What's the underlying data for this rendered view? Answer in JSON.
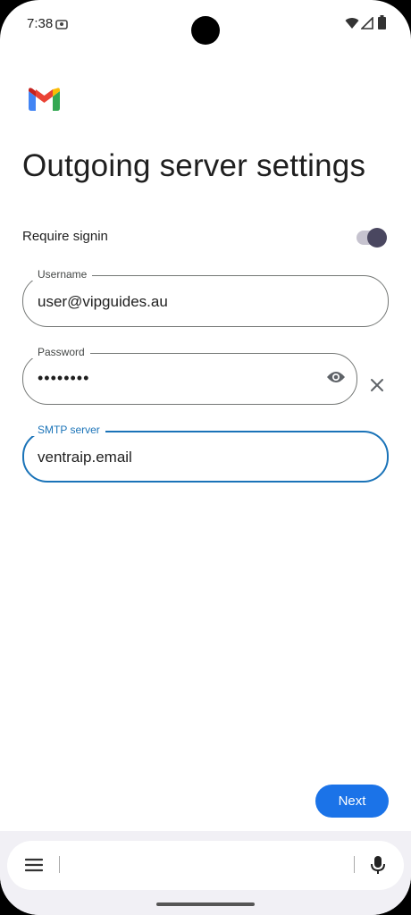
{
  "status_bar": {
    "time": "7:38",
    "icons": [
      "notification-icon",
      "wifi-icon",
      "signal-icon",
      "battery-icon"
    ]
  },
  "app": {
    "logo": "gmail-logo"
  },
  "page": {
    "title": "Outgoing server settings"
  },
  "require_signin": {
    "label": "Require signin",
    "enabled": true
  },
  "username": {
    "label": "Username",
    "value": "user@vipguides.au"
  },
  "password": {
    "label": "Password",
    "value": "••••••••",
    "icons": [
      "visibility-icon",
      "close-icon"
    ]
  },
  "smtp": {
    "label": "SMTP server",
    "value": "ventraip.email",
    "focused": true
  },
  "actions": {
    "next_label": "Next"
  },
  "keyboard_bar": {
    "icons": [
      "menu-icon",
      "mic-icon"
    ]
  },
  "colors": {
    "accent": "#1b73e8",
    "focus": "#1a73b8",
    "switch_thumb": "#4a4760"
  }
}
